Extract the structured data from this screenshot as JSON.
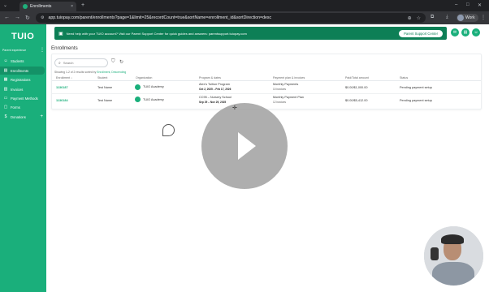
{
  "browser": {
    "tab_title": "Enrollments",
    "tab_close": "×",
    "new_tab": "+",
    "url": "app.tuiopay.com/parent/enrollments?page=1&limit=25&recordCount=true&sortName=enrollment_id&sortDirection=desc",
    "profile_name": "Work"
  },
  "sidebar": {
    "logo": "TUIO",
    "section_label": "Parent experience",
    "items": [
      {
        "label": "Students",
        "icon": "user-icon"
      },
      {
        "label": "Enrollments",
        "icon": "document-icon"
      },
      {
        "label": "Registrations",
        "icon": "clipboard-icon"
      },
      {
        "label": "Invoices",
        "icon": "invoice-icon"
      },
      {
        "label": "Payment Methods",
        "icon": "card-icon"
      },
      {
        "label": "Forms",
        "icon": "form-icon"
      },
      {
        "label": "Donations",
        "icon": "dollar-icon"
      }
    ]
  },
  "banner": {
    "text": "Need help with your TUIO account? Visit our Parent Support Center for quick guides and answers: parentsupport.tuiopay.com",
    "button": "Parent Support Center"
  },
  "page": {
    "title": "Enrollments",
    "search_placeholder": "Search",
    "results_prefix": "Showing 1-2 of 2 results sorted by",
    "results_sort": "Enrollment, Descending"
  },
  "table": {
    "headers": [
      "Enrollment ↓",
      "Student",
      "Organization",
      "Program & dates",
      "Payment plan & invoices",
      "Paid/Total amount",
      "Status"
    ],
    "rows": [
      {
        "enrollment": "1136187",
        "student": "Test Name",
        "organization": "TUIO Academy",
        "program": "Alex's Tuition Program",
        "dates": "Oct 2, 2025 – Feb 17, 2026",
        "plan": "Monthly Payments",
        "invoices": "10 invoices",
        "amount": "$0.00/$1,000.00",
        "status": "Pending payment setup"
      },
      {
        "enrollment": "1136184",
        "student": "Test Name",
        "organization": "TUIO Academy",
        "program": "CC95 – Nursery School",
        "dates": "Sep 29 – Nov 29, 2025",
        "plan": "Monthly Payment Plan",
        "invoices": "12 invoices",
        "amount": "$0.00/$5,412.00",
        "status": "Pending payment setup"
      }
    ]
  },
  "colors": {
    "brand": "#1aaf7b",
    "banner": "#0d7f56"
  }
}
